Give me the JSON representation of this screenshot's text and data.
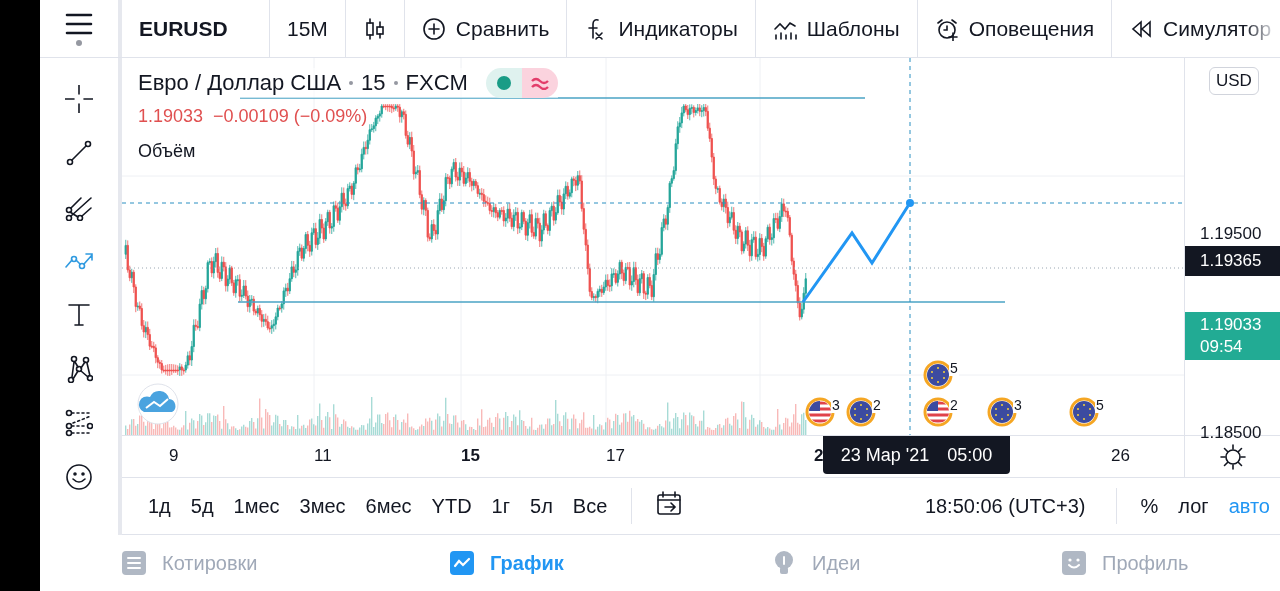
{
  "toolbar": {
    "items": [
      {
        "kind": "symbol",
        "label": "EURUSD"
      },
      {
        "kind": "interval",
        "label": "15M"
      },
      {
        "kind": "chart_type"
      },
      {
        "kind": "compare",
        "label": "Сравнить"
      },
      {
        "kind": "indicators",
        "label": "Индикаторы"
      },
      {
        "kind": "templates",
        "label": "Шаблоны"
      },
      {
        "kind": "alerts",
        "label": "Оповещения"
      },
      {
        "kind": "replay",
        "label": "Симулятор"
      }
    ]
  },
  "sidebar": {
    "tools": [
      {
        "kind": "crosshair",
        "selected": false
      },
      {
        "kind": "trendline",
        "selected": false
      },
      {
        "kind": "pitchfork",
        "selected": false
      },
      {
        "kind": "path",
        "selected": true
      },
      {
        "kind": "text",
        "selected": false
      },
      {
        "kind": "pattern",
        "selected": false
      },
      {
        "kind": "measure",
        "selected": false
      },
      {
        "kind": "emoji",
        "selected": false
      }
    ]
  },
  "legend": {
    "symbol": "Евро / Доллар США",
    "interval": "15",
    "source": "FXCM",
    "price": "1.19033",
    "change": "−0.00109 (−0.09%)",
    "volume_label": "Объём"
  },
  "price_axis": {
    "currency": "USD",
    "labels": [
      {
        "kind": "tick",
        "text": "1.19500"
      },
      {
        "kind": "crosshair",
        "text": "1.19365"
      },
      {
        "kind": "last",
        "text": "1.19033",
        "countdown": "09:54"
      },
      {
        "kind": "tick",
        "text": "1.18500"
      }
    ]
  },
  "events": [
    {
      "kind": "us",
      "count": "3"
    },
    {
      "kind": "eu",
      "count": "2"
    },
    {
      "kind": "eu",
      "count": "5"
    },
    {
      "kind": "us",
      "count": "2"
    },
    {
      "kind": "eu",
      "count": "3"
    },
    {
      "kind": "eu",
      "count": "5"
    }
  ],
  "time_axis": {
    "ticks": [
      {
        "text": "9",
        "bold": false
      },
      {
        "text": "11",
        "bold": false
      },
      {
        "text": "15",
        "bold": true
      },
      {
        "text": "17",
        "bold": false
      },
      {
        "text": "2",
        "bold": true
      },
      {
        "text": "26",
        "bold": false
      }
    ],
    "crosshair_label": {
      "date": "23 Мар '21",
      "time": "05:00"
    }
  },
  "range_bar": {
    "ranges": [
      "1д",
      "5д",
      "1мес",
      "3мес",
      "6мес",
      "YTD",
      "1г",
      "5л",
      "Все"
    ],
    "clock": "18:50:06 (UTC+3)",
    "scale_options": [
      {
        "label": "%",
        "on": false
      },
      {
        "label": "лог",
        "on": false
      },
      {
        "label": "авто",
        "on": true
      }
    ]
  },
  "nav": [
    {
      "kind": "quotes",
      "label": "Котировки",
      "selected": false
    },
    {
      "kind": "chart",
      "label": "График",
      "selected": true
    },
    {
      "kind": "ideas",
      "label": "Идеи",
      "selected": false
    },
    {
      "kind": "profile",
      "label": "Профиль",
      "selected": false
    }
  ]
}
